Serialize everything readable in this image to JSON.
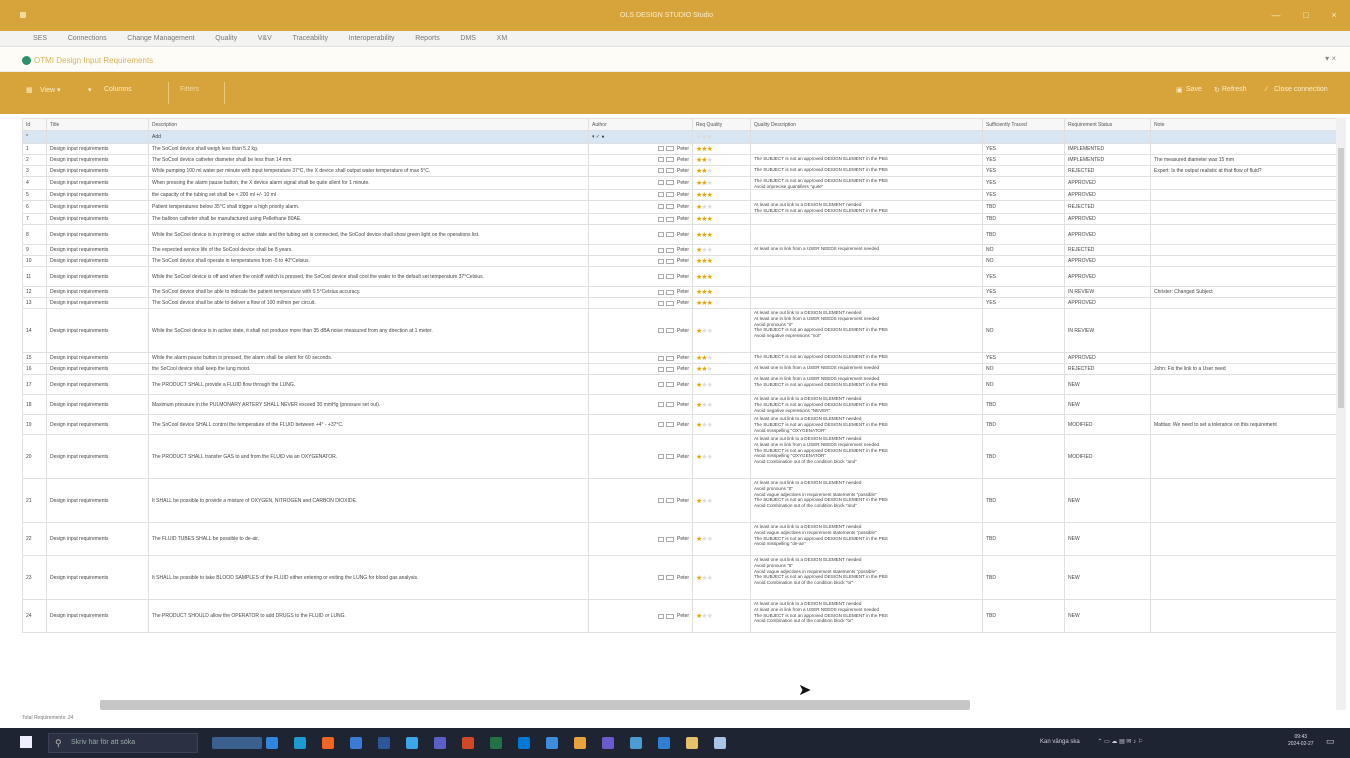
{
  "window": {
    "title": "OLS DESIGN STUDIO Studio",
    "controls": [
      "—",
      "□",
      "×"
    ]
  },
  "menu": [
    "SES",
    "Connections",
    "Change Management",
    "Quality",
    "V&V",
    "Traceability",
    "Interoperability",
    "Reports",
    "DMS",
    "XM"
  ],
  "doc_tab": {
    "title": "OTMI Design Input Requirements"
  },
  "toolbar": {
    "view": "View ▾",
    "columns": "Columns",
    "filter": "Filters",
    "save": "Save",
    "refresh": "Refresh",
    "close_connection": "Close connection"
  },
  "columns": [
    "Id",
    "Title",
    "Description",
    "Author",
    "Req Quality",
    "Quality Description",
    "Sufficiently Traced",
    "Requirement Status",
    "Note"
  ],
  "new_row_hint": "Add",
  "rows": [
    {
      "id": "1",
      "title": "Design input requirements",
      "desc": "The SoCool device shall weigh less than 5.2 kg.",
      "author": "Peter",
      "stars": 3,
      "qdesc": "",
      "traced": "YES",
      "status": "IMPLEMENTED",
      "note": "",
      "h": 1
    },
    {
      "id": "2",
      "title": "Design input requirements",
      "desc": "The SoCool device catheter diameter shall be less than 14 mm.",
      "author": "Peter",
      "stars": 2,
      "qdesc": "The SUBJECT is not an approved DESIGN ELEMENT in the PBS",
      "traced": "YES",
      "status": "IMPLEMENTED",
      "note": "The measured diameter was 15 mm",
      "h": 1
    },
    {
      "id": "3",
      "title": "Design input requirements",
      "desc": "While pumping 100 ml water per minute with input temperature 37°C, the X device shall output water temperature of max 5°C.",
      "author": "Peter",
      "stars": 2,
      "qdesc": "The SUBJECT is not an approved DESIGN ELEMENT in the PBS",
      "traced": "YES",
      "status": "REJECTED",
      "note": "Expert: Is the output realistic at that flow of fluid?",
      "h": 1
    },
    {
      "id": "4",
      "title": "Design input requirements",
      "desc": "When pressing the alarm pause button, the X device alarm signal shall be quite silent for 1 minute.",
      "author": "Peter",
      "stars": 2,
      "qdesc": "The SUBJECT is not an approved DESIGN ELEMENT in the PBS\nAvoid imprecise quantifiers \"quite\"",
      "traced": "YES",
      "status": "APPROVED",
      "note": "",
      "h": 1
    },
    {
      "id": "5",
      "title": "Design input requirements",
      "desc": "the capacity of the tubing set shall be < 200 ml +/- 10 ml",
      "author": "Peter",
      "stars": 3,
      "qdesc": "",
      "traced": "YES",
      "status": "APPROVED",
      "note": "",
      "h": 1
    },
    {
      "id": "6",
      "title": "Design input requirements",
      "desc": "Patient temperatures below 35°C shall trigger a high priority alarm.",
      "author": "Peter",
      "stars": 1,
      "qdesc": "At least one out link to a DESIGN ELEMENT needed\nThe SUBJECT is not an approved DESIGN ELEMENT in the PBS",
      "traced": "TBD",
      "status": "REJECTED",
      "note": "",
      "h": 1
    },
    {
      "id": "7",
      "title": "Design input requirements",
      "desc": "The balloon catheter shall be manufactured using Pellethane 80AE.",
      "author": "Peter",
      "stars": 3,
      "qdesc": "",
      "traced": "TBD",
      "status": "APPROVED",
      "note": "",
      "h": 1
    },
    {
      "id": "8",
      "title": "Design input requirements",
      "desc": "While the SoCool device is in priming or active state and the tubing set is connected, the SoCool device shall show green light on the operations list.",
      "author": "Peter",
      "stars": 3,
      "qdesc": "",
      "traced": "TBD",
      "status": "APPROVED",
      "note": "",
      "h": 2
    },
    {
      "id": "9",
      "title": "Design input requirements",
      "desc": "The expected service life of the SoCool device shall be 8 years.",
      "author": "Peter",
      "stars": 1,
      "qdesc": "At least one in link from a USER NEEDS requirement needed",
      "traced": "NO",
      "status": "REJECTED",
      "note": "",
      "h": 1
    },
    {
      "id": "10",
      "title": "Design input requirements",
      "desc": "The SoCool device shall operate in temperatures from -5 to 40°Celsius.",
      "author": "Peter",
      "stars": 3,
      "qdesc": "",
      "traced": "NO",
      "status": "APPROVED",
      "note": "",
      "h": 1
    },
    {
      "id": "11",
      "title": "Design input requirements",
      "desc": "While the SoCool device is off and when the on/off switch is pressed, the SoCool device shall cool the water to the default set temperature 37°Celsius.",
      "author": "Peter",
      "stars": 3,
      "qdesc": "",
      "traced": "YES",
      "status": "APPROVED",
      "note": "",
      "h": 2
    },
    {
      "id": "12",
      "title": "Design input requirements",
      "desc": "The SoCool device shall be able to indicate the patient temperature with 0.5°Celsius accuracy.",
      "author": "Peter",
      "stars": 3,
      "qdesc": "",
      "traced": "YES",
      "status": "IN REVIEW",
      "note": "Christer: Changed Subject",
      "h": 1
    },
    {
      "id": "13",
      "title": "Design input requirements",
      "desc": "The SoCool device shall be able to deliver a flow of 100 ml/min per circuit.",
      "author": "Peter",
      "stars": 3,
      "qdesc": "",
      "traced": "YES",
      "status": "APPROVED",
      "note": "",
      "h": 1
    },
    {
      "id": "14",
      "title": "Design input requirements",
      "desc": "While the SoCool device is in active state, it shall not produce more than 35 dBA noise measured from any direction at 1 meter.",
      "author": "Peter",
      "stars": 1,
      "qdesc": "At least one out link to a DESIGN ELEMENT needed\nAt least one in link from a USER NEEDS requirement needed\nAvoid pronouns \"it\"\nThe SUBJECT is not an approved DESIGN ELEMENT in the PBS\nAvoid negative expressions \"not\"",
      "traced": "NO",
      "status": "IN REVIEW",
      "note": "",
      "h": 4
    },
    {
      "id": "15",
      "title": "Design input requirements",
      "desc": "While the alarm pause button is pressed, the alarm shall be silent for 60 seconds.",
      "author": "Peter",
      "stars": 2,
      "qdesc": "The SUBJECT is not an approved DESIGN ELEMENT in the PBS",
      "traced": "YES",
      "status": "APPROVED",
      "note": "",
      "h": 1
    },
    {
      "id": "16",
      "title": "Design input requirements",
      "desc": "the SoCool device shall keep the lung moist.",
      "author": "Peter",
      "stars": 2,
      "qdesc": "At least one in link from a USER NEEDS requirement needed",
      "traced": "NO",
      "status": "REJECTED",
      "note": "John: Fix the link to a User need",
      "h": 1
    },
    {
      "id": "17",
      "title": "Design input requirements",
      "desc": "The PRODUCT SHALL provide a FLUID flow through the LUNG.",
      "author": "Peter",
      "stars": 1,
      "qdesc": "At least one in link from a USER NEEDS requirement needed\nThe SUBJECT is not an approved DESIGN ELEMENT in the PBS",
      "traced": "NO",
      "status": "NEW",
      "note": "",
      "h": 2
    },
    {
      "id": "18",
      "title": "Design input requirements",
      "desc": "Maximum pressure in the PULMONARY ARTERY SHALL NEVER exceed 30 mmHg (pressure set out).",
      "author": "Peter",
      "stars": 1,
      "qdesc": "At least one out link to a DESIGN ELEMENT needed\nThe SUBJECT is not an approved DESIGN ELEMENT in the PBS\nAvoid negative expressions \"NEVER\"",
      "traced": "TBD",
      "status": "NEW",
      "note": "",
      "h": 2
    },
    {
      "id": "19",
      "title": "Design input requirements",
      "desc": "The SoCool device SHALL control the temperature of the FLUID between +4° - +37°C.",
      "author": "Peter",
      "stars": 1,
      "qdesc": "At least one out link to a DESIGN ELEMENT needed\nThe SUBJECT is not an approved DESIGN ELEMENT in the PBS\nAvoid misspelling \"OXYGENATOR\"",
      "traced": "TBD",
      "status": "MODIFIED",
      "note": "Mattias: We need to set a tolerance on this requirement",
      "h": 2
    },
    {
      "id": "20",
      "title": "Design input requirements",
      "desc": "The PRODUCT SHALL transfer GAS to and from the FLUID via an OXYGENATOR.",
      "author": "Peter",
      "stars": 1,
      "qdesc": "At least one out link to a DESIGN ELEMENT needed\nAt least one in link from a USER NEEDS requirement needed\nThe SUBJECT is not an approved DESIGN ELEMENT in the PBS\nAvoid misspelling \"OXYGENATOR\"\nAvoid Combination out of the condition block \"and\"",
      "traced": "TBD",
      "status": "MODIFIED",
      "note": "",
      "h": 4
    },
    {
      "id": "21",
      "title": "Design input requirements",
      "desc": "It SHALL be possible to provide a mixture of OXYGEN, NITROGEN and CARBON DIOXIDE.",
      "author": "Peter",
      "stars": 1,
      "qdesc": "At least one out link to a DESIGN ELEMENT needed\nAvoid pronouns \"It\"\nAvoid vague adjectives in requirement statements \"possible\"\nThe SUBJECT is not an approved DESIGN ELEMENT in the PBS\nAvoid Combination out of the condition block \"and\"",
      "traced": "TBD",
      "status": "NEW",
      "note": "",
      "h": 4
    },
    {
      "id": "22",
      "title": "Design input requirements",
      "desc": "The FLUID TUBES SHALL be possible to de-air.",
      "author": "Peter",
      "stars": 1,
      "qdesc": "At least one out link to a DESIGN ELEMENT needed\nAvoid vague adjectives in requirement statements \"possible\"\nThe SUBJECT is not an approved DESIGN ELEMENT in the PBS\nAvoid misspelling \"de-air\"",
      "traced": "TBD",
      "status": "NEW",
      "note": "",
      "h": 3
    },
    {
      "id": "23",
      "title": "Design input requirements",
      "desc": "It SHALL be possible to take BLOOD SAMPLES of the FLUID either entering or exiting the LUNG for blood gas analysis.",
      "author": "Peter",
      "stars": 1,
      "qdesc": "At least one out link to a DESIGN ELEMENT needed\nAvoid pronouns \"It\"\nAvoid vague adjectives in requirement statements \"possible\"\nThe SUBJECT is not an approved DESIGN ELEMENT in the PBS\nAvoid Combination out of the condition block \"or\"",
      "traced": "TBD",
      "status": "NEW",
      "note": "",
      "h": 4
    },
    {
      "id": "24",
      "title": "Design input requirements",
      "desc": "The PRODUCT SHOULD allow the OPERATOR to add DRUGS to the FLUID or LUNG.",
      "author": "Peter",
      "stars": 1,
      "qdesc": "At least one out link to a DESIGN ELEMENT needed\nAt least one in link from a USER NEEDS requirement needed\nThe SUBJECT is not an approved DESIGN ELEMENT in the PBS\nAvoid Combination out of the condition block \"or\"",
      "traced": "TBD",
      "status": "NEW",
      "note": "",
      "h": 3
    }
  ],
  "status_bar": "Total Requirements: 24",
  "taskbar": {
    "search_placeholder": "Skriv här för att söka",
    "tray_text": "Kan vänga ska",
    "time": "09:43",
    "date": "2024-02-27"
  },
  "colors": {
    "accent": "#d7a43c",
    "star_on": "#e0a500",
    "selected_row": "#d8e6f4",
    "taskbar": "#1f2433"
  }
}
